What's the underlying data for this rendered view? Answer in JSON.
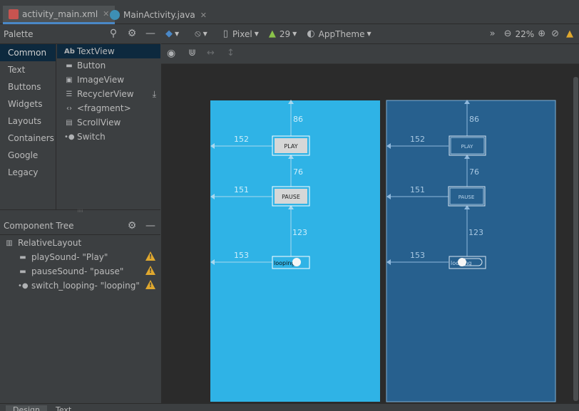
{
  "tabs": [
    {
      "label": "activity_main.xml",
      "active": true
    },
    {
      "label": "MainActivity.java",
      "active": false
    }
  ],
  "palette": {
    "title": "Palette",
    "categories": [
      "Common",
      "Text",
      "Buttons",
      "Widgets",
      "Layouts",
      "Containers",
      "Google",
      "Legacy"
    ],
    "items": [
      {
        "icon": "Ab",
        "label": "TextView"
      },
      {
        "icon": "button-icon",
        "label": "Button"
      },
      {
        "icon": "image-icon",
        "label": "ImageView"
      },
      {
        "icon": "list-icon",
        "label": "RecyclerView"
      },
      {
        "icon": "code-icon",
        "label": "<fragment>"
      },
      {
        "icon": "scroll-icon",
        "label": "ScrollView"
      },
      {
        "icon": "switch-icon",
        "label": "Switch"
      }
    ]
  },
  "component_tree": {
    "title": "Component Tree",
    "root": "RelativeLayout",
    "children": [
      {
        "id": "playSound",
        "text": "- \"Play\""
      },
      {
        "id": "pauseSound",
        "text": "- \"pause\""
      },
      {
        "id": "switch_looping",
        "text": "- \"looping\""
      }
    ]
  },
  "toolbar": {
    "device": "Pixel",
    "api": "29",
    "theme": "AppTheme",
    "zoom": "22%"
  },
  "design": {
    "play_label": "PLAY",
    "pause_label": "PAUSE",
    "looping_label": "looping",
    "blueprint_play": "PLAY",
    "blueprint_pause": "PAUSE",
    "blueprint_looping": "looping",
    "dims": {
      "top": "86",
      "play_left": "152",
      "play_pause": "76",
      "pause_left": "151",
      "pause_switch": "123",
      "switch_left": "153"
    }
  },
  "bottom_tabs": [
    "Design",
    "Text"
  ],
  "colors": {
    "accent": "#4a88c7",
    "design_bg": "#2fb3e6",
    "blueprint_bg": "#27608e",
    "warning": "#e0a82e"
  }
}
